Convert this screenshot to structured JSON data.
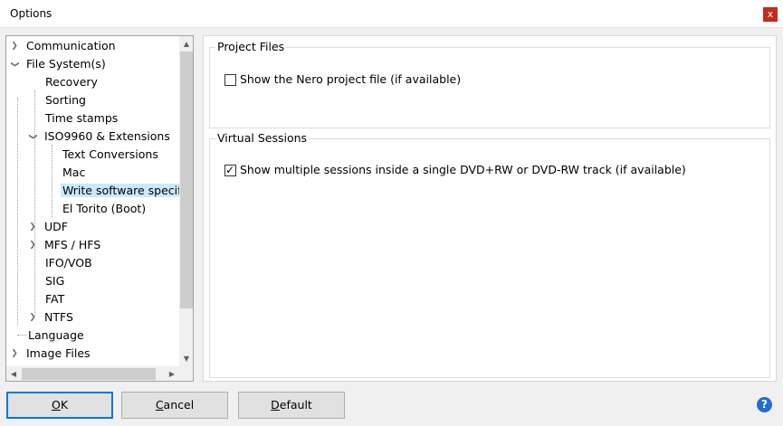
{
  "window": {
    "title": "Options",
    "close_glyph": "x"
  },
  "tree": {
    "items": [
      {
        "label": "Communication",
        "expander": "collapsed"
      },
      {
        "label": "File System(s)",
        "expander": "expanded"
      },
      {
        "label": "Recovery",
        "expander": "none"
      },
      {
        "label": "Sorting",
        "expander": "none"
      },
      {
        "label": "Time stamps",
        "expander": "none"
      },
      {
        "label": "ISO9960 & Extensions",
        "expander": "expanded"
      },
      {
        "label": "Text Conversions",
        "expander": "none"
      },
      {
        "label": "Mac",
        "expander": "none"
      },
      {
        "label": "Write software specific",
        "expander": "none",
        "selected": true
      },
      {
        "label": "El Torito (Boot)",
        "expander": "none"
      },
      {
        "label": "UDF",
        "expander": "collapsed"
      },
      {
        "label": "MFS / HFS",
        "expander": "collapsed"
      },
      {
        "label": "IFO/VOB",
        "expander": "none"
      },
      {
        "label": "SIG",
        "expander": "none"
      },
      {
        "label": "FAT",
        "expander": "none"
      },
      {
        "label": "NTFS",
        "expander": "collapsed"
      },
      {
        "label": "Language",
        "expander": "none"
      },
      {
        "label": "Image Files",
        "expander": "collapsed"
      }
    ]
  },
  "project_files": {
    "title": "Project Files",
    "show_project_file": {
      "label": "Show the Nero project file (if available)",
      "checked": false
    }
  },
  "virtual_sessions": {
    "title": "Virtual Sessions",
    "show_multiple_sessions": {
      "label": "Show multiple sessions inside a single DVD+RW or DVD-RW track (if available)",
      "checked": true
    }
  },
  "buttons": {
    "ok": {
      "mnemonic": "O",
      "rest": "K"
    },
    "cancel": {
      "mnemonic": "C",
      "rest": "ancel"
    },
    "default": {
      "mnemonic": "D",
      "rest": "efault"
    }
  },
  "help": {
    "glyph": "?"
  },
  "colors": {
    "selection": "#cce8ff",
    "close_red": "#c42b1c",
    "accent_blue": "#0078d7",
    "help_blue": "#1f6fd1"
  }
}
